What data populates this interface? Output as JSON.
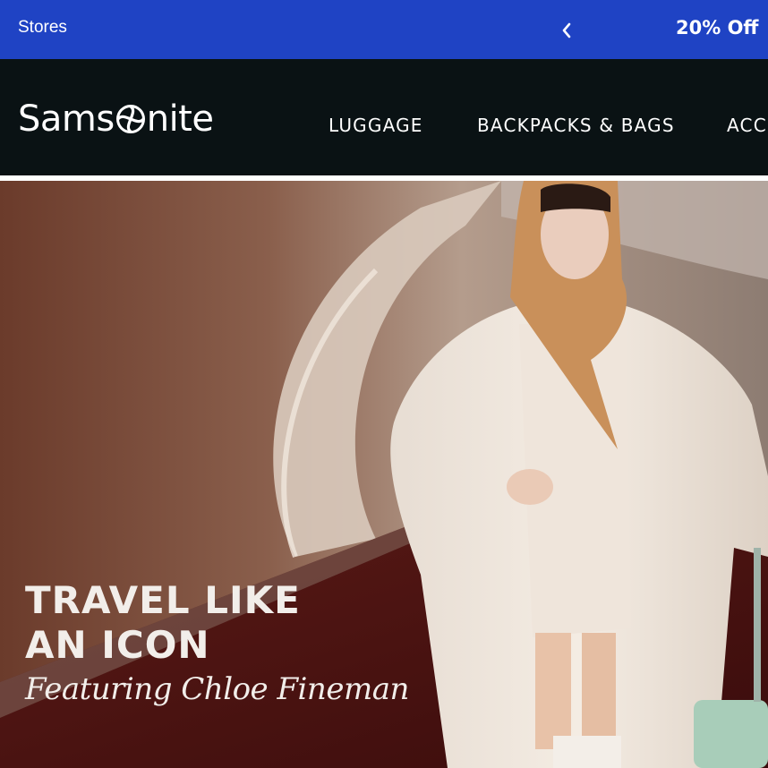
{
  "promo_bar": {
    "stores_label": "Stores",
    "prev_icon": "chevron-left-icon",
    "offer_text": "20% Off",
    "background_color": "#1f43c4"
  },
  "header": {
    "logo_text_left": "Sams",
    "logo_text_right": "nite",
    "logo_icon": "samsonite-swirl-icon",
    "background_color": "#0a1214",
    "nav": [
      {
        "label": "LUGGAGE"
      },
      {
        "label": "BACKPACKS & BAGS"
      },
      {
        "label": "ACC"
      }
    ]
  },
  "hero": {
    "title_line1": "TRAVEL LIKE",
    "title_line2": "AN ICON",
    "subtitle": "Featuring Chloe Fineman"
  }
}
